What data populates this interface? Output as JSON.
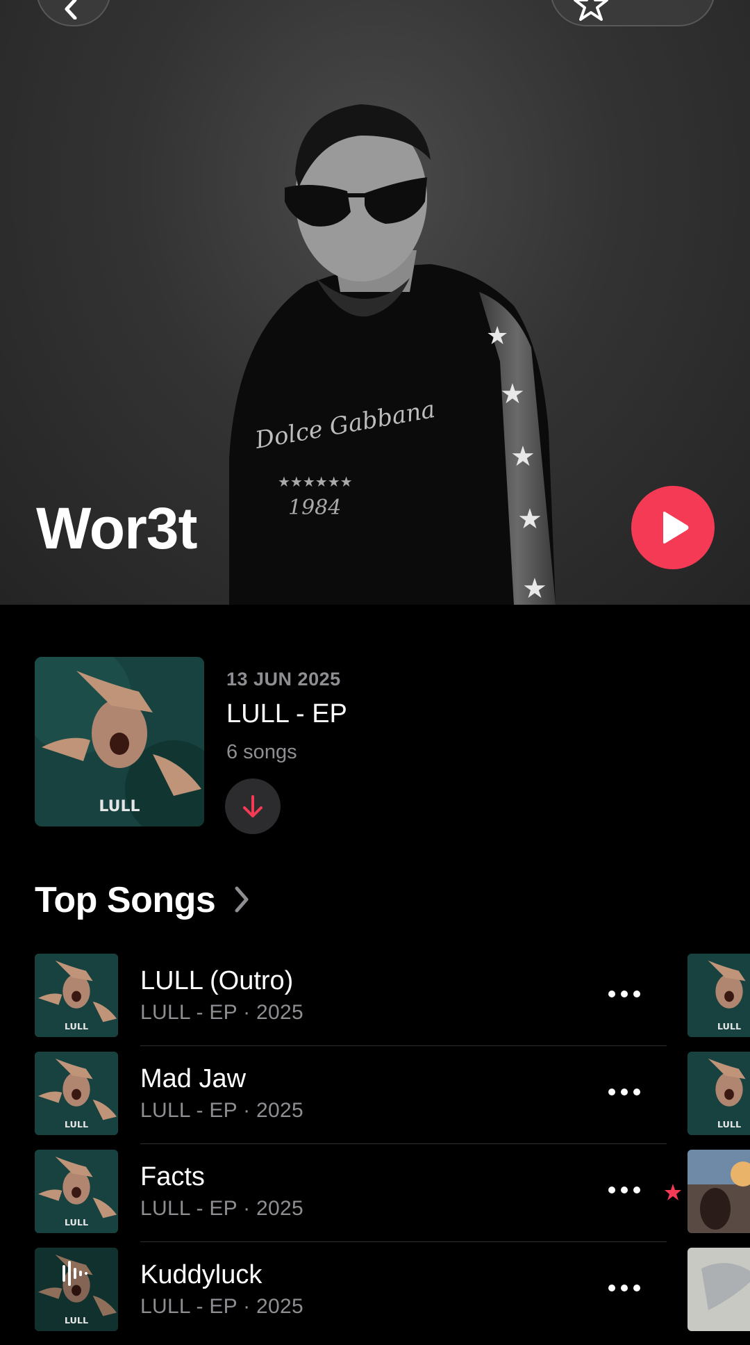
{
  "artist": {
    "name": "Wor3t"
  },
  "latest_release": {
    "date": "13 JUN 2025",
    "title": "LULL - EP",
    "song_count": "6 songs",
    "cover_text": "LULL"
  },
  "top_songs": {
    "header": "Top Songs",
    "items": [
      {
        "title": "LULL (Outro)",
        "subtitle": "LULL - EP · 2025",
        "cover_text": "LULL"
      },
      {
        "title": "Mad Jaw",
        "subtitle": "LULL - EP · 2025",
        "cover_text": "LULL"
      },
      {
        "title": "Facts",
        "subtitle": "LULL - EP · 2025",
        "cover_text": "LULL"
      },
      {
        "title": "Kuddyluck",
        "subtitle": "LULL - EP · 2025",
        "cover_text": "LULL"
      }
    ]
  },
  "icons": {
    "back": "chevron-left-icon",
    "favorite": "star-icon",
    "play": "play-icon",
    "download": "arrow-down-icon",
    "more": "ellipsis-icon",
    "section": "chevron-right-icon",
    "now_playing": "waveform-icon"
  },
  "colors": {
    "accent": "#f53a55",
    "secondary_text": "#8e8e93",
    "background": "#000000"
  }
}
